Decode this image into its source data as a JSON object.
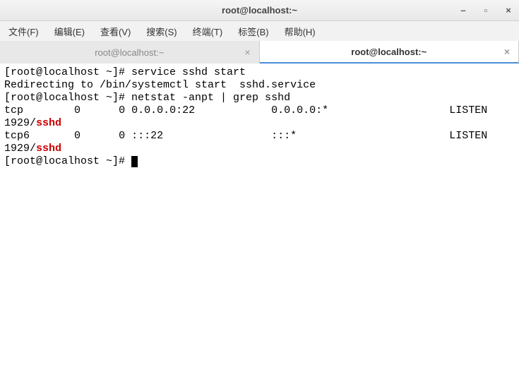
{
  "titlebar": {
    "title": "root@localhost:~",
    "minimize": "–",
    "maximize": "▫",
    "close": "×"
  },
  "menubar": {
    "items": [
      "文件(F)",
      "编辑(E)",
      "查看(V)",
      "搜索(S)",
      "终端(T)",
      "标签(B)",
      "帮助(H)"
    ]
  },
  "tabs": [
    {
      "label": "root@localhost:~",
      "active": false
    },
    {
      "label": "root@localhost:~",
      "active": true
    }
  ],
  "tab_close": "×",
  "terminal": {
    "line1_prompt": "[root@localhost ~]# ",
    "line1_cmd": "service sshd start",
    "line2": "Redirecting to /bin/systemctl start  sshd.service",
    "line3_prompt": "[root@localhost ~]# ",
    "line3_cmd": "netstat -anpt | grep sshd",
    "row1": {
      "proto": "tcp",
      "recvq": "0",
      "sendq": "0",
      "local": "0.0.0.0:22",
      "foreign": "0.0.0.0:*",
      "state": "LISTEN"
    },
    "row1_pid": "1929/",
    "row1_proc": "sshd",
    "row2": {
      "proto": "tcp6",
      "recvq": "0",
      "sendq": "0",
      "local": ":::22",
      "foreign": ":::*",
      "state": "LISTEN"
    },
    "row2_pid": "1929/",
    "row2_proc": "sshd",
    "line_prompt_empty": "[root@localhost ~]# "
  }
}
